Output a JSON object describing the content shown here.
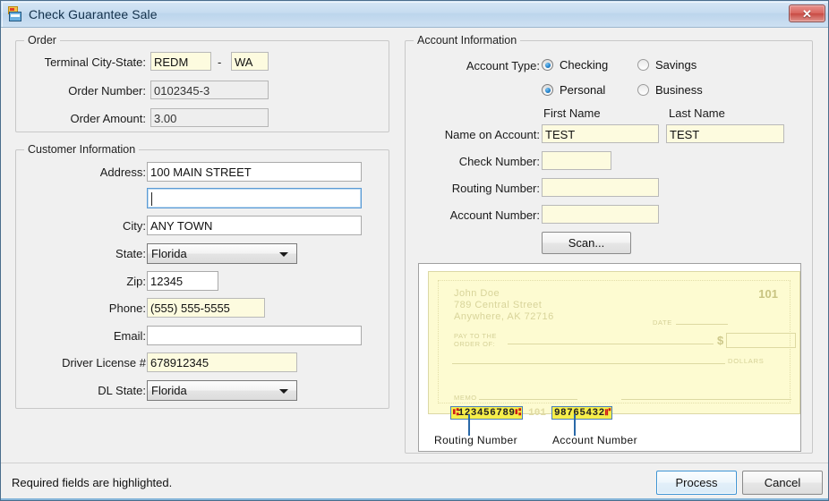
{
  "window": {
    "title": "Check Guarantee Sale",
    "icon": "check-card-icon",
    "close_label": "✕"
  },
  "order": {
    "legend": "Order",
    "fields": [
      {
        "label": "Terminal City-State:",
        "value": "REDM",
        "state": "required"
      },
      {
        "label": "",
        "value": "WA",
        "state": "required"
      },
      {
        "label": "Order Number:",
        "value": "0102345-3",
        "state": "readonly"
      },
      {
        "label": "Order Amount:",
        "value": "3.00",
        "state": "readonly"
      }
    ],
    "separator": "-"
  },
  "customer": {
    "legend": "Customer Information",
    "address_label": "Address:",
    "address_line1": "100 MAIN STREET",
    "address_line2": "",
    "city_label": "City:",
    "city": "ANY TOWN",
    "state_label": "State:",
    "state": "Florida",
    "zip_label": "Zip:",
    "zip": "12345",
    "phone_label": "Phone:",
    "phone": "(555) 555-5555",
    "email_label": "Email:",
    "email": "",
    "dl_label": "Driver License #",
    "dl_number": "678912345",
    "dl_state_label": "DL State:",
    "dl_state": "Florida"
  },
  "account": {
    "legend": "Account Information",
    "account_type_label": "Account Type:",
    "radios": [
      {
        "label": "Checking",
        "checked": true
      },
      {
        "label": "Savings",
        "checked": false
      },
      {
        "label": "Personal",
        "checked": true
      },
      {
        "label": "Business",
        "checked": false
      }
    ],
    "first_name_header": "First Name",
    "last_name_header": "Last Name",
    "name_label": "Name on Account:",
    "first_name": "TEST",
    "last_name": "TEST",
    "check_number_label": "Check Number:",
    "check_number": "",
    "routing_number_label": "Routing Number:",
    "routing_number": "",
    "account_number_label": "Account Number:",
    "account_number": "",
    "scan_label": "Scan..."
  },
  "check_preview": {
    "payer_name": "John Doe",
    "payer_street": "789 Central Street",
    "payer_citystate": "Anywhere, AK 72716",
    "check_number": "101",
    "date_label": "DATE",
    "pay_to_line1": "PAY TO THE",
    "pay_to_line2": "ORDER OF:",
    "dollar_sign": "$",
    "dollars_label": "DOLLARS",
    "memo_label": "MEMO",
    "micr_routing": "123456789",
    "micr_routing_symbol": "⑆",
    "micr_check_number": "101",
    "micr_account": "98765432",
    "micr_account_symbol": "⑈",
    "callout_routing": "Routing Number",
    "callout_account": "Account Number"
  },
  "footer": {
    "note": "Required fields are highlighted.",
    "process_label": "Process",
    "cancel_label": "Cancel"
  },
  "colors": {
    "required_field_bg": "#fdfbdf",
    "titlebar": "#c6dcf0",
    "accent": "#3c93d4",
    "check_paper": "#fdfbd1",
    "micr_highlight": "#f6ee4a"
  }
}
